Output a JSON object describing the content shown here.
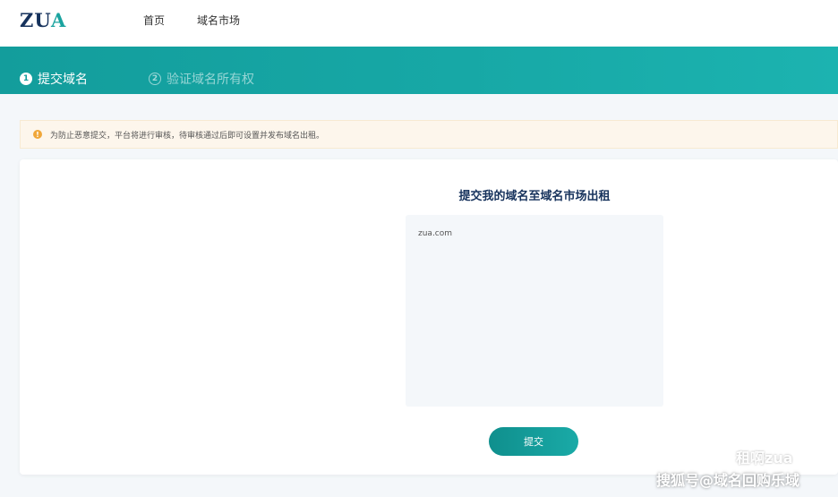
{
  "brand": {
    "logo_part1": "ZU",
    "logo_part2": "A"
  },
  "nav": {
    "items": [
      "首页",
      "域名市场"
    ]
  },
  "steps": [
    {
      "num": "1",
      "label": "提交域名",
      "active": true
    },
    {
      "num": "2",
      "label": "验证域名所有权",
      "active": false
    }
  ],
  "notice": {
    "text": "为防止恶意提交，平台将进行审核，待审核通过后即可设置并发布域名出租。"
  },
  "card": {
    "title": "提交我的域名至域名市场出租",
    "domain_value": "zua.com",
    "submit_label": "提交"
  },
  "watermark": {
    "wechat": "租啊zua",
    "sohu": "搜狐号@域名回购乐域"
  },
  "colors": {
    "teal": "#17a8a6",
    "navy": "#16325c",
    "warning": "#f0a73a"
  }
}
